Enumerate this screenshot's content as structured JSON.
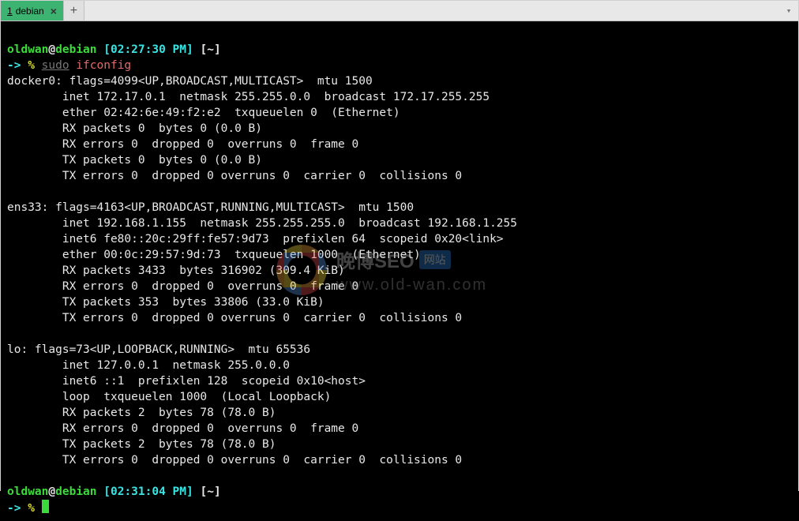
{
  "tab": {
    "index": "1",
    "title": "debian",
    "close": "×",
    "new": "+",
    "menu": "▾"
  },
  "prompt1": {
    "user": "oldwan",
    "at": "@",
    "host": "debian",
    "time": "[02:27:30 PM]",
    "cwd": "[~]",
    "arrow": "->",
    "pct": "%",
    "cmd_sudo": "sudo",
    "cmd_args": "ifconfig"
  },
  "output": {
    "l01": "docker0: flags=4099<UP,BROADCAST,MULTICAST>  mtu 1500",
    "l02": "        inet 172.17.0.1  netmask 255.255.0.0  broadcast 172.17.255.255",
    "l03": "        ether 02:42:6e:49:f2:e2  txqueuelen 0  (Ethernet)",
    "l04": "        RX packets 0  bytes 0 (0.0 B)",
    "l05": "        RX errors 0  dropped 0  overruns 0  frame 0",
    "l06": "        TX packets 0  bytes 0 (0.0 B)",
    "l07": "        TX errors 0  dropped 0 overruns 0  carrier 0  collisions 0",
    "l08": "",
    "l09": "ens33: flags=4163<UP,BROADCAST,RUNNING,MULTICAST>  mtu 1500",
    "l10": "        inet 192.168.1.155  netmask 255.255.255.0  broadcast 192.168.1.255",
    "l11": "        inet6 fe80::20c:29ff:fe57:9d73  prefixlen 64  scopeid 0x20<link>",
    "l12": "        ether 00:0c:29:57:9d:73  txqueuelen 1000  (Ethernet)",
    "l13": "        RX packets 3433  bytes 316902 (309.4 KiB)",
    "l14": "        RX errors 0  dropped 0  overruns 0  frame 0",
    "l15": "        TX packets 353  bytes 33806 (33.0 KiB)",
    "l16": "        TX errors 0  dropped 0 overruns 0  carrier 0  collisions 0",
    "l17": "",
    "l18": "lo: flags=73<UP,LOOPBACK,RUNNING>  mtu 65536",
    "l19": "        inet 127.0.0.1  netmask 255.0.0.0",
    "l20": "        inet6 ::1  prefixlen 128  scopeid 0x10<host>",
    "l21": "        loop  txqueuelen 1000  (Local Loopback)",
    "l22": "        RX packets 2  bytes 78 (78.0 B)",
    "l23": "        RX errors 0  dropped 0  overruns 0  frame 0",
    "l24": "        TX packets 2  bytes 78 (78.0 B)",
    "l25": "        TX errors 0  dropped 0 overruns 0  carrier 0  collisions 0",
    "l26": ""
  },
  "prompt2": {
    "user": "oldwan",
    "at": "@",
    "host": "debian",
    "time": "[02:31:04 PM]",
    "cwd": "[~]",
    "arrow": "->",
    "pct": "%"
  },
  "watermark": {
    "line1_text": "晚博SEO",
    "badge": "网站",
    "line2": "www.old-wan.com"
  }
}
